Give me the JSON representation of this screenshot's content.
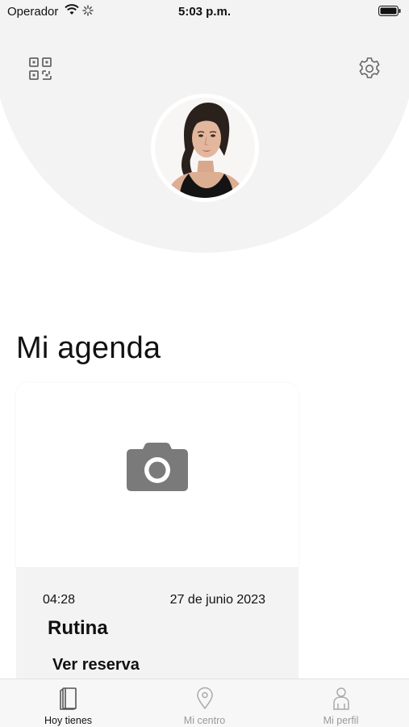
{
  "status_bar": {
    "carrier": "Operador",
    "time": "5:03 p.m."
  },
  "header": {
    "qr_icon": "qr-code-icon",
    "settings_icon": "gear-icon",
    "avatar": "profile-photo"
  },
  "agenda": {
    "title": "Mi agenda",
    "photo_placeholder_icon": "camera-icon",
    "time": "04:28",
    "date": "27 de junio 2023",
    "routine": "Rutina",
    "see_reservation": "Ver reserva"
  },
  "tabs": [
    {
      "label": "Hoy tienes",
      "icon": "notebook-icon",
      "active": true
    },
    {
      "label": "Mi centro",
      "icon": "map-pin-icon",
      "active": false
    },
    {
      "label": "Mi perfil",
      "icon": "person-icon",
      "active": false
    }
  ],
  "colors": {
    "header_bg": "#f3f3f3",
    "panel_bg": "#f3f3f3",
    "camera_gray": "#7a7a7a",
    "tab_inactive": "#9a9a9a"
  }
}
